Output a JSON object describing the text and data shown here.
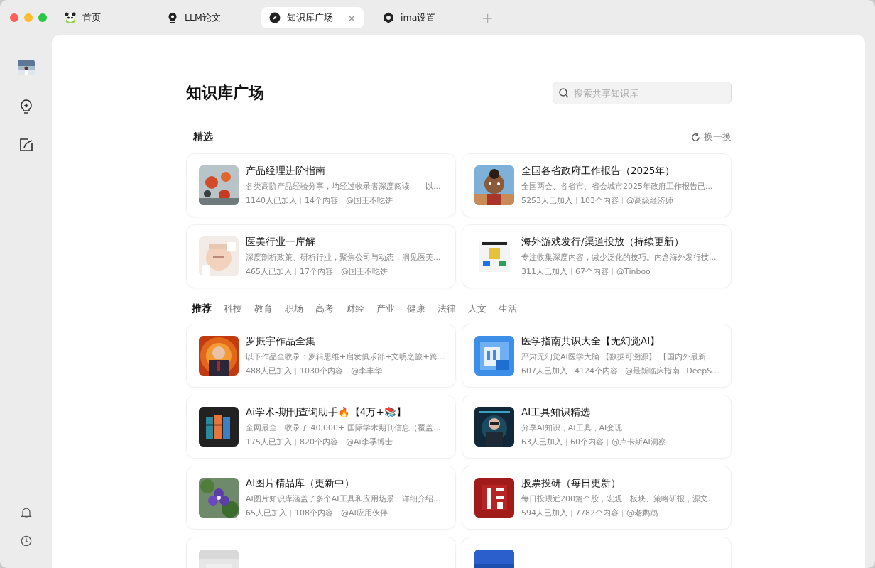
{
  "tabs": [
    {
      "label": "首页",
      "kind": "panda",
      "selected": false
    },
    {
      "label": "LLM论文",
      "kind": "pin",
      "selected": false
    },
    {
      "label": "知识库广场",
      "kind": "compass",
      "selected": true,
      "close": "×"
    },
    {
      "label": "ima设置",
      "kind": "hexagon",
      "selected": false
    }
  ],
  "new_tab": "+",
  "page_title": "知识库广场",
  "search": {
    "placeholder": "搜索共享知识库"
  },
  "featured": {
    "heading": "精选",
    "refresh": "换一换",
    "cards": [
      {
        "title": "产品经理进阶指南",
        "desc": "各类高阶产品经验分享，均经过收录者深度阅读——以...",
        "meta": [
          "1140人已加入",
          "14个内容",
          "@国王不吃饼"
        ]
      },
      {
        "title": "全国各省政府工作报告（2025年）",
        "desc": "全国两会、各省市、省会城市2025年政府工作报告已...",
        "meta": [
          "5253人已加入",
          "103个内容",
          "@高级经济师"
        ]
      },
      {
        "title": "医美行业一库解",
        "desc": "深度剖析政策、研析行业，聚焦公司与动态，洞见医美...",
        "meta": [
          "465人已加入",
          "17个内容",
          "@国王不吃饼"
        ]
      },
      {
        "title": "海外游戏发行/渠道投放（持续更新）",
        "desc": "专注收集深度内容，减少泛化的技巧。内含海外发行技...",
        "meta": [
          "311人已加入",
          "67个内容",
          "@Tinboo"
        ]
      }
    ]
  },
  "categories": [
    {
      "label": "推荐",
      "selected": true
    },
    {
      "label": "科技",
      "selected": false
    },
    {
      "label": "教育",
      "selected": false
    },
    {
      "label": "职场",
      "selected": false
    },
    {
      "label": "高考",
      "selected": false
    },
    {
      "label": "财经",
      "selected": false
    },
    {
      "label": "产业",
      "selected": false
    },
    {
      "label": "健康",
      "selected": false
    },
    {
      "label": "法律",
      "selected": false
    },
    {
      "label": "人文",
      "selected": false
    },
    {
      "label": "生活",
      "selected": false
    }
  ],
  "recommended": [
    {
      "title": "罗振宇作品全集",
      "desc": "以下作品全收录：罗辑思维+启发俱乐部+文明之旅+跨...",
      "meta": [
        "488人已加入",
        "1030个内容",
        "@李丰华"
      ]
    },
    {
      "title": "医学指南共识大全【无幻觉AI】",
      "desc": "严肃无幻觉AI医学大脑 【数据可溯源】 【国内外最新...",
      "meta": [
        "607人已加入",
        "4124个内容",
        "@最新临床指南+DeepS..."
      ]
    },
    {
      "title": "Ai学术-期刊查询助手🔥【4万+📚】",
      "desc": "全网最全，收录了 40,000+ 国际学术期刊信息（覆盖...",
      "meta": [
        "175人已加入",
        "820个内容",
        "@Ai李孚博士"
      ]
    },
    {
      "title": "AI工具知识精选",
      "desc": "分享AI知识，AI工具，AI变现",
      "meta": [
        "63人已加入",
        "60个内容",
        "@卢卡斯AI洞察"
      ]
    },
    {
      "title": "AI图片精品库（更新中）",
      "desc": "AI图片知识库涵盖了多个AI工具和应用场景，详细介绍...",
      "meta": [
        "65人已加入",
        "108个内容",
        "@AI应用伙伴"
      ]
    },
    {
      "title": "股票投研（每日更新）",
      "desc": "每日投喂近200篇个股，宏观、板块、策略研报，源文...",
      "meta": [
        "594人已加入",
        "7782个内容",
        "@老鹦鹉"
      ]
    },
    {
      "kind": "cut"
    },
    {
      "kind": "cut"
    }
  ]
}
